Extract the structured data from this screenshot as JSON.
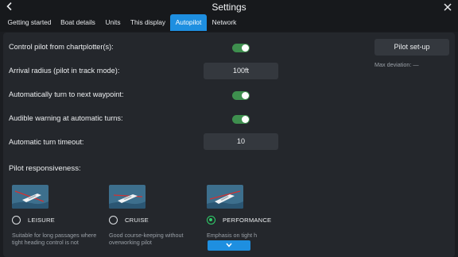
{
  "header": {
    "title": "Settings",
    "back_icon": "chevron-left-icon",
    "close_icon": "close-icon"
  },
  "tabs": [
    {
      "label": "Getting started",
      "active": false
    },
    {
      "label": "Boat details",
      "active": false
    },
    {
      "label": "Units",
      "active": false
    },
    {
      "label": "This display",
      "active": false
    },
    {
      "label": "Autopilot",
      "active": true
    },
    {
      "label": "Network",
      "active": false
    }
  ],
  "settings": {
    "control_pilot": {
      "label": "Control pilot from chartplotter(s):",
      "on": true
    },
    "arrival_radius": {
      "label": "Arrival radius (pilot in track mode):",
      "value": "100ft"
    },
    "auto_turn": {
      "label": "Automatically turn to next waypoint:",
      "on": true
    },
    "audible_warning": {
      "label": "Audible warning at automatic turns:",
      "on": true
    },
    "turn_timeout": {
      "label": "Automatic turn timeout:",
      "value": "10"
    }
  },
  "side": {
    "pilot_setup_label": "Pilot set-up",
    "max_deviation_label": "Max deviation: —"
  },
  "responsiveness": {
    "title": "Pilot responsiveness:",
    "modes": [
      {
        "label": "LEISURE",
        "selected": false,
        "description": "Suitable for long passages where tight heading control is not"
      },
      {
        "label": "CRUISE",
        "selected": false,
        "description": "Good course-keeping without overworking pilot"
      },
      {
        "label": "PERFORMANCE",
        "selected": true,
        "description": "Emphasis on tight h"
      }
    ]
  },
  "colors": {
    "accent": "#1e8fe0",
    "toggle_on": "#3e8f4e",
    "radio_selected": "#2fd06a"
  },
  "scroll_icon": "chevron-down-icon"
}
